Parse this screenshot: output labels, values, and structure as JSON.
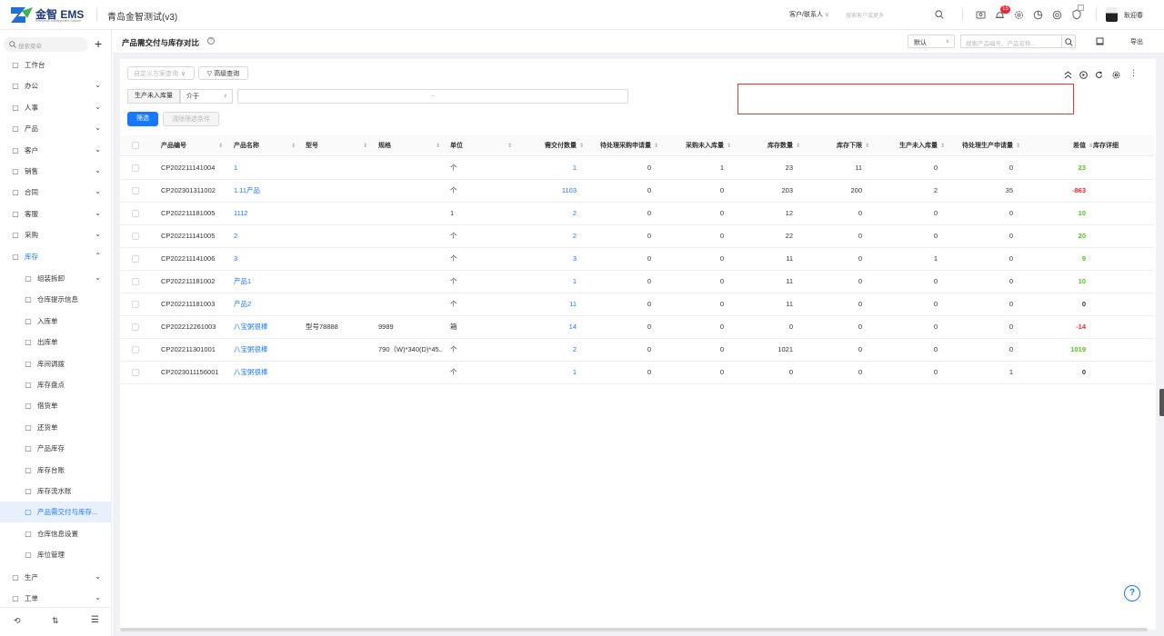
{
  "app": {
    "logo_text": "金智 EMS",
    "logo_sub": "Enterprise Management System",
    "company": "青岛金智测试(v3)"
  },
  "topbar": {
    "customer_select": "客户/联系人",
    "search_placeholder": "搜索客户或更多",
    "badge_count": "15",
    "user_name": "耿迎春"
  },
  "sidebar": {
    "search_placeholder": "搜索菜单",
    "items": [
      {
        "label": "工作台",
        "icon": "dashboard-icon",
        "chevron": ""
      },
      {
        "label": "办公",
        "icon": "office-icon",
        "chevron": "v"
      },
      {
        "label": "人事",
        "icon": "person-icon",
        "chevron": "v"
      },
      {
        "label": "产品",
        "icon": "product-icon",
        "chevron": "v"
      },
      {
        "label": "客户",
        "icon": "customer-icon",
        "chevron": "v"
      },
      {
        "label": "销售",
        "icon": "sales-icon",
        "chevron": "v"
      },
      {
        "label": "合同",
        "icon": "contract-icon",
        "chevron": "v"
      },
      {
        "label": "客服",
        "icon": "service-icon",
        "chevron": "v"
      },
      {
        "label": "采购",
        "icon": "purchase-icon",
        "chevron": "v"
      },
      {
        "label": "库存",
        "icon": "inventory-icon",
        "chevron": "^"
      }
    ],
    "sub_items": [
      {
        "label": "组装拆卸",
        "icon": "assemble-icon",
        "chevron": "v"
      },
      {
        "label": "仓库提示信息",
        "icon": "info-icon",
        "chevron": ""
      },
      {
        "label": "入库单",
        "icon": "inbound-icon",
        "chevron": ""
      },
      {
        "label": "出库单",
        "icon": "outbound-icon",
        "chevron": ""
      },
      {
        "label": "库间调拨",
        "icon": "transfer-icon",
        "chevron": ""
      },
      {
        "label": "库存盘点",
        "icon": "stocktake-icon",
        "chevron": ""
      },
      {
        "label": "借货单",
        "icon": "borrow-icon",
        "chevron": ""
      },
      {
        "label": "还货单",
        "icon": "return-icon",
        "chevron": ""
      },
      {
        "label": "产品库存",
        "icon": "product-stock-icon",
        "chevron": ""
      },
      {
        "label": "库存台账",
        "icon": "ledger-icon",
        "chevron": ""
      },
      {
        "label": "库存流水账",
        "icon": "journal-icon",
        "chevron": ""
      },
      {
        "label": "产品需交付与库存...",
        "icon": "compare-icon",
        "chevron": ""
      },
      {
        "label": "仓库信息设置",
        "icon": "settings-icon",
        "chevron": ""
      },
      {
        "label": "库位管理",
        "icon": "location-icon",
        "chevron": ""
      }
    ],
    "bottom_items": [
      {
        "label": "生产",
        "icon": "production-icon",
        "chevron": "v"
      },
      {
        "label": "工单",
        "icon": "workorder-icon",
        "chevron": "v"
      }
    ]
  },
  "page": {
    "title": "产品需交付与库存对比",
    "view_select": "默认",
    "search_placeholder": "搜索产品编号、产品名称...",
    "export_label": "导出"
  },
  "filters": {
    "saved_query": "自定义方案查询",
    "advanced": "高级查询",
    "field": "生产未入库量",
    "operator": "介于",
    "range_sep": "~",
    "filter_btn": "筛选",
    "clear_btn": "清除筛选条件"
  },
  "table": {
    "headers": [
      "产品编号",
      "产品名称",
      "型号",
      "规格",
      "单位",
      "需交付数量",
      "待处理采购申请量",
      "采购未入库量",
      "库存数量",
      "库存下限",
      "生产未入库量",
      "待处理生产申请量",
      "差值",
      "库存详细"
    ],
    "rows": [
      {
        "code": "CP202211141004",
        "name": "1",
        "model": "",
        "spec": "",
        "unit": "个",
        "deliver": "1",
        "pending_pur": "0",
        "pur_not_in": "1",
        "stock": "23",
        "min": "11",
        "prod_not_in": "0",
        "pending_prod": "0",
        "diff": "23",
        "diff_color": "green"
      },
      {
        "code": "CP202301311002",
        "name": "1.11产品",
        "model": "",
        "spec": "",
        "unit": "个",
        "deliver": "1103",
        "pending_pur": "0",
        "pur_not_in": "0",
        "stock": "203",
        "min": "200",
        "prod_not_in": "2",
        "pending_prod": "35",
        "diff": "-863",
        "diff_color": "red"
      },
      {
        "code": "CP202211181005",
        "name": "1112",
        "model": "",
        "spec": "",
        "unit": "1",
        "deliver": "2",
        "pending_pur": "0",
        "pur_not_in": "0",
        "stock": "12",
        "min": "0",
        "prod_not_in": "0",
        "pending_prod": "0",
        "diff": "10",
        "diff_color": "green"
      },
      {
        "code": "CP202211141005",
        "name": "2",
        "model": "",
        "spec": "",
        "unit": "个",
        "deliver": "2",
        "pending_pur": "0",
        "pur_not_in": "0",
        "stock": "22",
        "min": "0",
        "prod_not_in": "0",
        "pending_prod": "0",
        "diff": "20",
        "diff_color": "green"
      },
      {
        "code": "CP202211141006",
        "name": "3",
        "model": "",
        "spec": "",
        "unit": "个",
        "deliver": "3",
        "pending_pur": "0",
        "pur_not_in": "0",
        "stock": "11",
        "min": "0",
        "prod_not_in": "1",
        "pending_prod": "0",
        "diff": "9",
        "diff_color": "green"
      },
      {
        "code": "CP202211181002",
        "name": "产品1",
        "model": "",
        "spec": "",
        "unit": "个",
        "deliver": "1",
        "pending_pur": "0",
        "pur_not_in": "0",
        "stock": "11",
        "min": "0",
        "prod_not_in": "0",
        "pending_prod": "0",
        "diff": "10",
        "diff_color": "green"
      },
      {
        "code": "CP202211181003",
        "name": "产品2",
        "model": "",
        "spec": "",
        "unit": "个",
        "deliver": "11",
        "pending_pur": "0",
        "pur_not_in": "0",
        "stock": "11",
        "min": "0",
        "prod_not_in": "0",
        "pending_prod": "0",
        "diff": "0",
        "diff_color": "black"
      },
      {
        "code": "CP202212261003",
        "name": "八宝粥很棒",
        "model": "型号78888",
        "spec": "9989",
        "unit": "箱",
        "deliver": "14",
        "pending_pur": "0",
        "pur_not_in": "0",
        "stock": "0",
        "min": "0",
        "prod_not_in": "0",
        "pending_prod": "0",
        "diff": "-14",
        "diff_color": "red"
      },
      {
        "code": "CP202211301001",
        "name": "八宝粥很棒",
        "model": "",
        "spec": "790（W)*340(D)*45...",
        "unit": "个",
        "deliver": "2",
        "pending_pur": "0",
        "pur_not_in": "0",
        "stock": "1021",
        "min": "0",
        "prod_not_in": "0",
        "pending_prod": "0",
        "diff": "1019",
        "diff_color": "green"
      },
      {
        "code": "CP2023011156001",
        "name": "八宝粥很棒",
        "model": "",
        "spec": "",
        "unit": "个",
        "deliver": "1",
        "pending_pur": "0",
        "pur_not_in": "0",
        "stock": "0",
        "min": "0",
        "prod_not_in": "0",
        "pending_prod": "1",
        "diff": "0",
        "diff_color": "black"
      }
    ]
  },
  "colors": {
    "primary": "#1677ff",
    "green": "#52c41a",
    "red": "#f5222d",
    "highlight": "#e53935"
  }
}
